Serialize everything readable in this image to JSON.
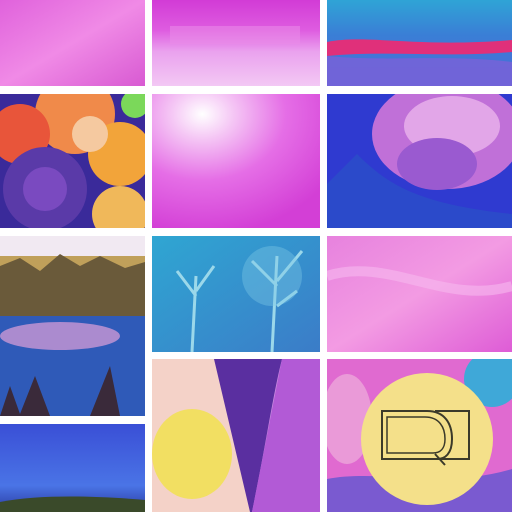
{
  "collage": {
    "tiles": [
      {
        "name": "pink-gradient-tile"
      },
      {
        "name": "magenta-lavender-tile"
      },
      {
        "name": "blue-red-abstract-tile"
      },
      {
        "name": "fruit-and-rose-tile"
      },
      {
        "name": "pink-glow-tile"
      },
      {
        "name": "pink-rose-tile"
      },
      {
        "name": "lake-reflection-tile"
      },
      {
        "name": "blue-winter-trees-tile"
      },
      {
        "name": "pink-fabric-tile"
      },
      {
        "name": "blue-sky-horizon-tile"
      },
      {
        "name": "yellow-purple-paper-tile"
      },
      {
        "name": "yellow-circle-sign-tile"
      }
    ]
  },
  "colors": {
    "pink": "#e05ad9",
    "magenta": "#d43fd8",
    "blue": "#2a3fd2",
    "cyan": "#3fb6e0",
    "yellow": "#f4e08a"
  }
}
